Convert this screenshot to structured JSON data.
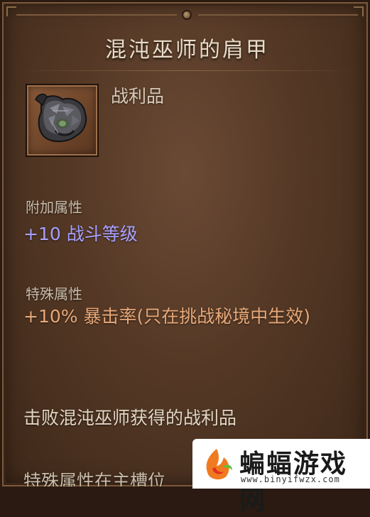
{
  "tooltip": {
    "title": "混沌巫师的肩甲",
    "item_type": "战利品",
    "item_icon": "pauldron-icon",
    "extra_attributes": {
      "label": "附加属性",
      "value": "+10 战斗等级"
    },
    "special_attributes": {
      "label": "特殊属性",
      "value": "+10% 暴击率(只在挑战秘境中生效)"
    },
    "flavor_text": "击败混沌巫师获得的战利品",
    "flavor_text_cut": "特殊属性在主槽位"
  },
  "watermark": {
    "site_name": "蝙蝠游戏网",
    "url": "www.binyifwzx.com"
  },
  "colors": {
    "panel_bg": "#543825",
    "title_text": "#e8dcc8",
    "blue_stat": "#a8a0ff",
    "orange_stat": "#e8a878"
  }
}
